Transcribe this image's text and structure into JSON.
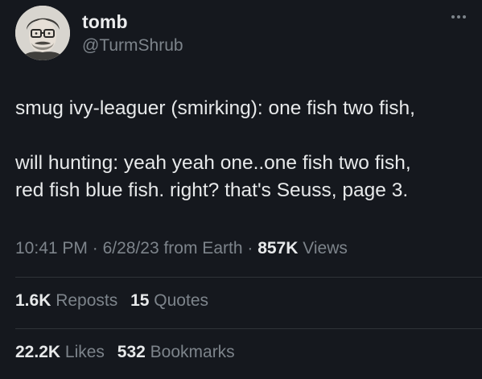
{
  "author": {
    "name": "tomb",
    "handle": "@TurmShrub"
  },
  "icons": {
    "more": "more-horizontal-icon",
    "avatar": "profile-photo"
  },
  "tweet": {
    "lines": [
      "smug ivy-leaguer (smirking): one fish two fish,",
      "will hunting: yeah yeah one..one fish two fish,",
      "red fish blue fish. right? that's Seuss, page 3."
    ]
  },
  "meta": {
    "time": "10:41 PM",
    "separator1": " · ",
    "date": "6/28/23",
    "source": " from Earth",
    "separator2": " · ",
    "views_count": "857K",
    "views_label": " Views"
  },
  "engagement": {
    "reposts_count": "1.6K",
    "reposts_label": "Reposts",
    "quotes_count": "15",
    "quotes_label": "Quotes",
    "likes_count": "22.2K",
    "likes_label": "Likes",
    "bookmarks_count": "532",
    "bookmarks_label": "Bookmarks"
  },
  "colors": {
    "background": "#15181e",
    "text": "#e7e9ea",
    "secondary": "#7d848b",
    "divider": "#2f3338"
  }
}
